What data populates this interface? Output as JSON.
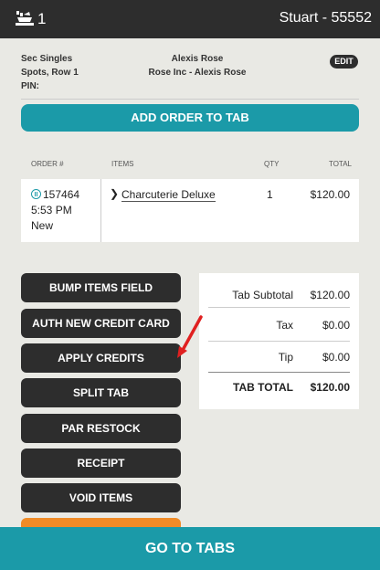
{
  "header": {
    "tab_count": "1",
    "user": "Stuart - 55552"
  },
  "info": {
    "section": "Sec Singles",
    "spots": "Spots, Row 1",
    "pin": "PIN:",
    "customer": "Alexis Rose",
    "company": "Rose Inc - Alexis Rose",
    "edit_label": "EDIT"
  },
  "actions": {
    "add_order": "ADD ORDER TO TAB"
  },
  "orders": {
    "headers": [
      "ORDER #",
      "ITEMS",
      "QTY",
      "TOTAL"
    ],
    "rows": [
      {
        "number": "157464",
        "time": "5:53 PM",
        "status": "New",
        "item": "Charcuterie Deluxe",
        "qty": "1",
        "total": "$120.00"
      }
    ]
  },
  "buttons": [
    "BUMP ITEMS FIELD",
    "AUTH NEW CREDIT CARD",
    "APPLY CREDITS",
    "SPLIT TAB",
    "PAR RESTOCK",
    "RECEIPT",
    "VOID ITEMS"
  ],
  "summary": {
    "subtotal_label": "Tab Subtotal",
    "subtotal_value": "$120.00",
    "tax_label": "Tax",
    "tax_value": "$0.00",
    "tip_label": "Tip",
    "tip_value": "$0.00",
    "total_label": "TAB TOTAL",
    "total_value": "$120.00"
  },
  "footer": {
    "go_to_tabs": "GO TO TABS"
  },
  "icons": {
    "tray": "tray-icon",
    "status": "pause-circle-icon",
    "expand": "chevron-right-icon"
  },
  "colors": {
    "accent": "#1b9aa8",
    "dark": "#2d2d2d",
    "orange": "#f08b27",
    "arrow": "#e02020"
  }
}
